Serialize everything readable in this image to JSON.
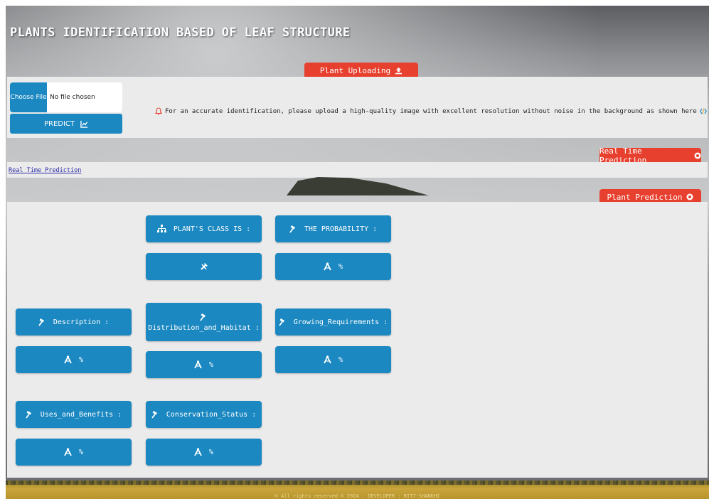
{
  "header": {
    "title": "PLANTS IDENTIFICATION BASED OF LEAF STRUCTURE"
  },
  "upload": {
    "tab_label": "Plant Uploading",
    "choose_file_label": "Choose File",
    "file_status": "No file chosen",
    "predict_label": "PREDICT",
    "notice": "For an accurate identification, please upload a high-quality image with excellent resolution without noise in the background as shown here"
  },
  "realtime": {
    "tab_label": "Real Time Prediction",
    "link_label": "Real Time Prediction"
  },
  "prediction": {
    "tab_label": "Plant Prediction",
    "plant_class_label": "PLANT'S CLASS IS :",
    "probability_label": "THE PROBABILITY :",
    "value_suffix": "%",
    "sections": {
      "description": "Description :",
      "distribution": "Distribution_and_Habitat :",
      "growing": "Growing_Requirements :",
      "uses": "Uses_and_Benefits :",
      "conservation": "Conservation_Status :"
    }
  },
  "footer": {
    "text": "© All rights reserved © 2024 . DEVELOPER : RIT7-SHANKHI"
  },
  "colors": {
    "accent": "#1b88c1",
    "tab_red": "#e8402e",
    "panel": "#ebebeb"
  },
  "icons": {
    "upload": "upload-icon",
    "chart": "chart-icon",
    "bell": "bell-icon",
    "code": "code-icon",
    "camera": "camera-icon",
    "sitemap": "sitemap-icon",
    "gavel": "gavel-icon",
    "tools": "tools-icon",
    "compass": "compass-icon"
  }
}
